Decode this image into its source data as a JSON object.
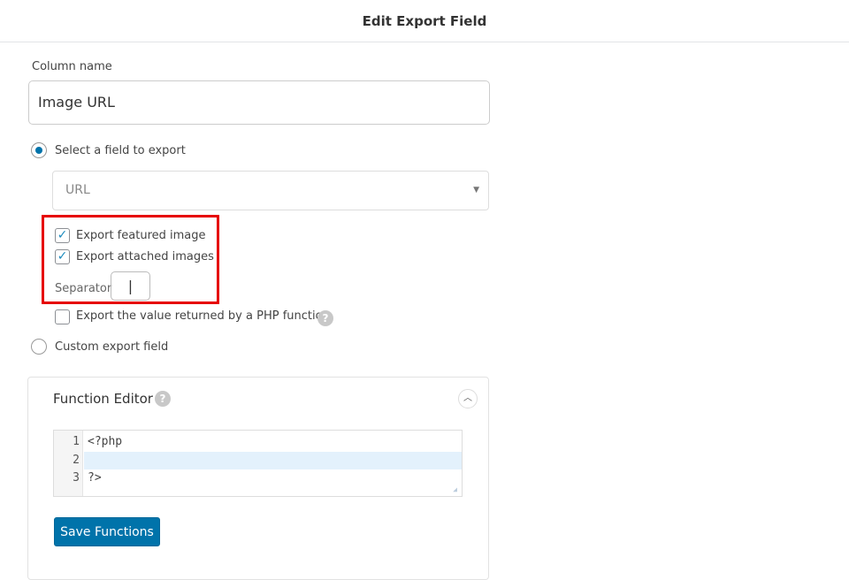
{
  "header": {
    "title": "Edit Export Field"
  },
  "column_name": {
    "label": "Column name",
    "value": "Image URL"
  },
  "select_field": {
    "label": "Select a field to export",
    "selected": true,
    "value": "URL"
  },
  "options": {
    "export_featured": {
      "label": "Export featured image",
      "checked": true
    },
    "export_attached": {
      "label": "Export attached images",
      "checked": true
    },
    "separator": {
      "label": "Separator",
      "value": "|"
    },
    "php_function": {
      "label": "Export the value returned by a PHP function",
      "checked": false
    }
  },
  "custom_field": {
    "label": "Custom export field",
    "selected": false
  },
  "function_editor": {
    "title": "Function Editor",
    "lines": [
      "1",
      "2",
      "3"
    ],
    "code": [
      "<?php",
      "",
      "?>"
    ],
    "save_label": "Save Functions"
  },
  "colors": {
    "accent": "#0073aa",
    "highlight": "#e60000"
  }
}
